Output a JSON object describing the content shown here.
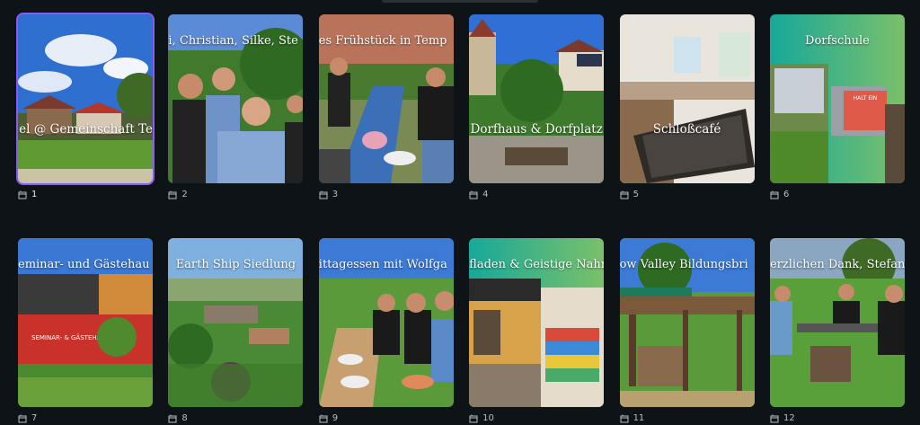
{
  "pages": [
    {
      "number": "1",
      "caption": "el @ Gemeinschaft Te",
      "selected": true
    },
    {
      "number": "2",
      "caption": "i, Christian, Silke, Ste"
    },
    {
      "number": "3",
      "caption": "es Frühstück in Temp"
    },
    {
      "number": "4",
      "caption": "Dorfhaus & Dorfplatz"
    },
    {
      "number": "5",
      "caption": "Schloßcafé"
    },
    {
      "number": "6",
      "caption": "Dorfschule",
      "sign_text": "HALT EIN"
    },
    {
      "number": "7",
      "caption": "eminar- und Gästehau",
      "sign_text": "SEMINAR- & GÄSTEHAUS"
    },
    {
      "number": "8",
      "caption": "Earth Ship Siedlung"
    },
    {
      "number": "9",
      "caption": "ittagessen mit Wolfga"
    },
    {
      "number": "10",
      "caption": "fladen & Geistige Nahr"
    },
    {
      "number": "11",
      "caption": "ow Valley Bildungsbri"
    },
    {
      "number": "12",
      "caption": "erzlichen Dank, Stefan"
    }
  ],
  "colors": {
    "selection": "#8a5cf6",
    "background": "#0e1318",
    "meta_text": "#b8bec7"
  },
  "icons": {
    "page": "page-icon"
  }
}
